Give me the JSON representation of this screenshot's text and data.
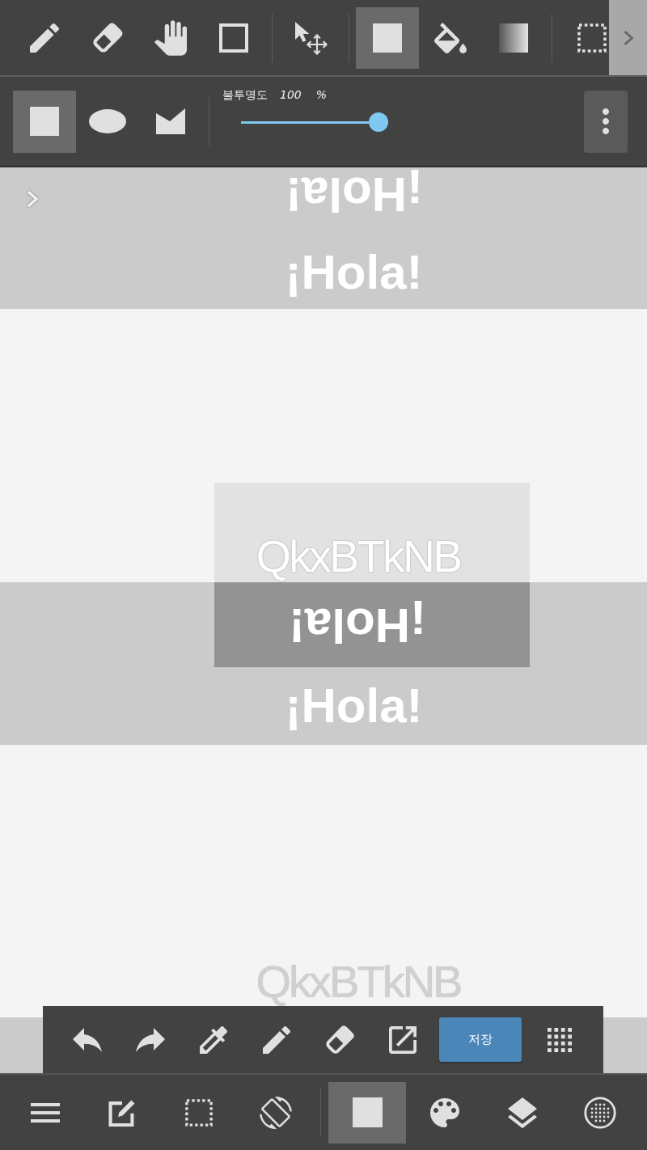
{
  "top_toolbar": {
    "tools": [
      {
        "selected": false
      },
      {
        "selected": false
      },
      {
        "selected": false
      },
      {
        "selected": false
      },
      {
        "selected": false
      },
      {
        "selected": true
      },
      {
        "selected": false
      },
      {
        "selected": false
      },
      {
        "selected": false
      }
    ]
  },
  "tool_options": {
    "shapes": [
      {
        "selected": true
      },
      {
        "selected": false
      },
      {
        "selected": false
      }
    ],
    "opacity": {
      "label": "불투명도",
      "value": "100",
      "unit": "%",
      "level": 1
    }
  },
  "canvas": {
    "top_band": {
      "upside_down_text": "¡Hola!",
      "text": "¡Hola!"
    },
    "faint_panel": {
      "text": "QkxBTkNB"
    },
    "middle_band": {
      "upside_down_text": "¡Hola!",
      "text": "¡Hola!"
    },
    "bottom_text": "QkxBTkNB"
  },
  "quick_toolbar": {
    "save_label": "저장"
  },
  "bottom_nav": {
    "items": [
      {
        "selected": false
      },
      {
        "selected": false
      },
      {
        "selected": false
      },
      {
        "selected": false
      },
      {
        "selected": true
      },
      {
        "selected": false
      },
      {
        "selected": false
      },
      {
        "selected": false
      }
    ]
  }
}
